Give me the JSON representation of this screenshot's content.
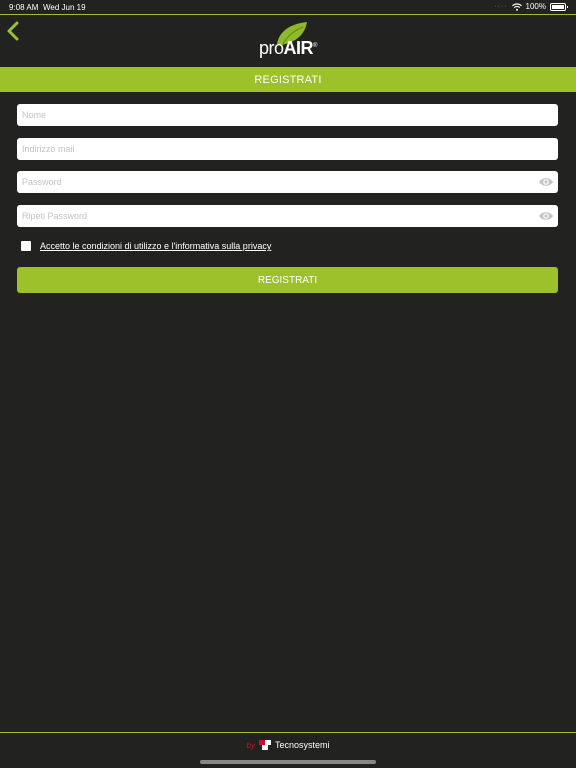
{
  "status": {
    "time": "9:08 AM",
    "date": "Wed Jun 19",
    "battery": "100%"
  },
  "logo": {
    "prefix": "pro",
    "suffix": "AIR",
    "reg": "®"
  },
  "page": {
    "title": "REGISTRATI"
  },
  "form": {
    "name_placeholder": "Nome",
    "email_placeholder": "Indirizzo mail",
    "password_placeholder": "Password",
    "repeat_password_placeholder": "Ripeti Password",
    "terms_label": "Accetto le condizioni di utilizzo e l'informativa sulla privacy",
    "submit_label": "REGISTRATI"
  },
  "footer": {
    "by": "by",
    "brand": "Tecnosystemi"
  },
  "colors": {
    "accent": "#9dc12b",
    "background": "#222220"
  }
}
